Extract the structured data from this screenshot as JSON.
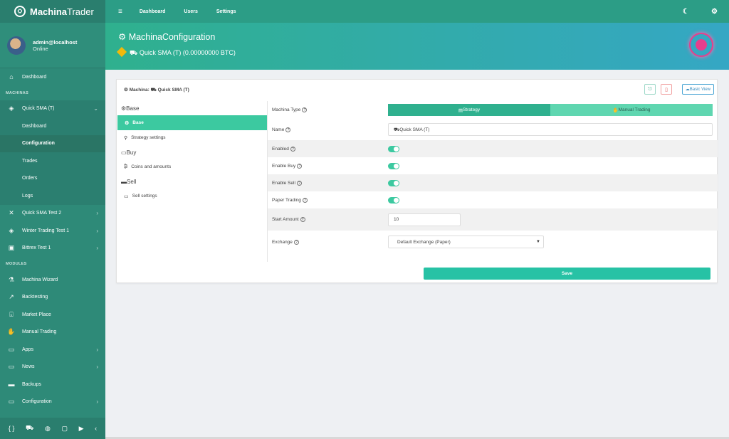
{
  "brand": {
    "name_a": "Machina",
    "name_b": "Trader"
  },
  "user": {
    "name": "admin@localhost",
    "status": "Online"
  },
  "sidebar": {
    "dashboard": "Dashboard",
    "machinas_section": "MACHINAS",
    "machinas": [
      {
        "label": "Quick SMA (T)",
        "expanded": true
      },
      {
        "label": "Quick SMA Test 2"
      },
      {
        "label": "Winter Trading Test 1"
      },
      {
        "label": "Bittrex Test 1"
      }
    ],
    "sub_items": [
      "Dashboard",
      "Configuration",
      "Trades",
      "Orders",
      "Logs"
    ],
    "modules_section": "MODULES",
    "modules": [
      "Machina Wizard",
      "Backtesting",
      "Market Place",
      "Manual Trading",
      "Apps",
      "News",
      "Backups",
      "Configuration"
    ]
  },
  "topbar": {
    "links": [
      "Dashboard",
      "Users",
      "Settings"
    ]
  },
  "header": {
    "title": "MachinaConfiguration",
    "subtitle": "Quick SMA (T)  (0.00000000 BTC)"
  },
  "card": {
    "title": "Machina: ",
    "machina_name": "Quick SMA (T)",
    "basic_view": "Basic View"
  },
  "left_panel": {
    "groups": [
      {
        "title": "Base",
        "items": [
          "Base",
          "Strategy settings"
        ]
      },
      {
        "title": "Buy",
        "items": [
          "Coins and amounts"
        ]
      },
      {
        "title": "Sell",
        "items": [
          "Sell settings"
        ]
      }
    ]
  },
  "form": {
    "machina_type_label": "Machina Type",
    "type_options": [
      "Strategy",
      "Manual Trading"
    ],
    "name_label": "Name",
    "name_value": "Quick SMA (T)",
    "enabled_label": "Enabled",
    "enable_buy_label": "Enable Buy",
    "enable_sell_label": "Enable Sell",
    "paper_trading_label": "Paper Trading",
    "start_amount_label": "Start Amount",
    "start_amount_value": "10",
    "exchange_label": "Exchange",
    "exchange_value": "Default Exchange (Paper)",
    "save_label": "Save"
  },
  "colors": {
    "accent": "#2fb08e",
    "sidebar": "#2e8a78",
    "save": "#27c2a5",
    "pulse": "#e83e8c"
  }
}
